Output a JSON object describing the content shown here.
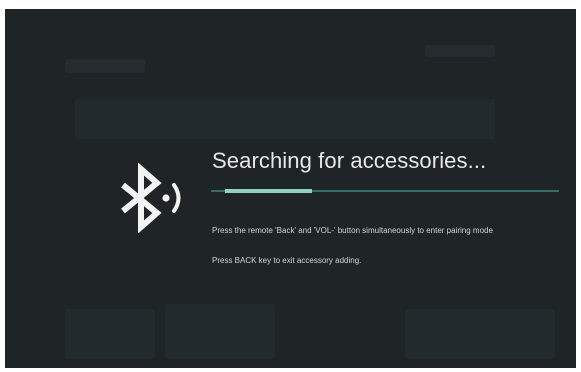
{
  "dialog": {
    "title": "Searching for accessories...",
    "progress_fraction": 0.25,
    "hint_pairing": "Press the remote 'Back' and 'VOL-' button simultaneously to enter pairing mode",
    "hint_exit": "Press BACK key to exit accessory adding."
  },
  "icons": {
    "main": "bluetooth-searching-icon"
  },
  "colors": {
    "background": "#1f2427",
    "progress_track": "#2f6f66",
    "progress_fill": "#8fd3c3",
    "text": "#e6e8e9"
  }
}
